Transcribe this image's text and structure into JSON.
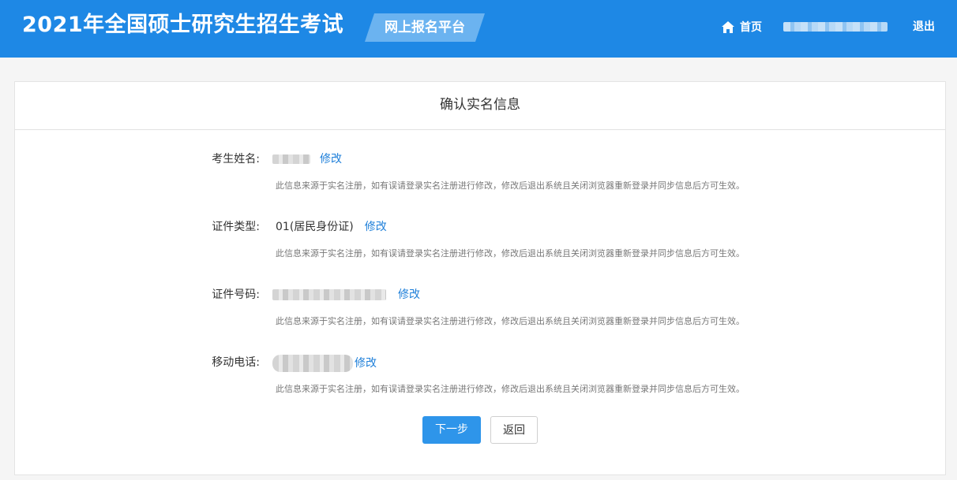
{
  "header": {
    "site_title": "2021年全国硕士研究生招生考试",
    "platform_badge": "网上报名平台",
    "home_label": "首页",
    "logout_label": "退出",
    "brand_color": "#1e88e5"
  },
  "card": {
    "title": "确认实名信息",
    "notice": "此信息来源于实名注册，如有误请登录实名注册进行修改，修改后退出系统且关闭浏览器重新登录并同步信息后方可生效。",
    "rows": [
      {
        "label": "考生姓名:",
        "value": "",
        "edit_label": "修改"
      },
      {
        "label": "证件类型:",
        "value": "01(居民身份证)",
        "edit_label": "修改"
      },
      {
        "label": "证件号码:",
        "value": "",
        "edit_label": "修改"
      },
      {
        "label": "移动电话:",
        "value": "",
        "edit_label": "修改"
      }
    ],
    "next_button": "下一步",
    "back_button": "返回"
  },
  "icons": {
    "home": "home-icon"
  }
}
